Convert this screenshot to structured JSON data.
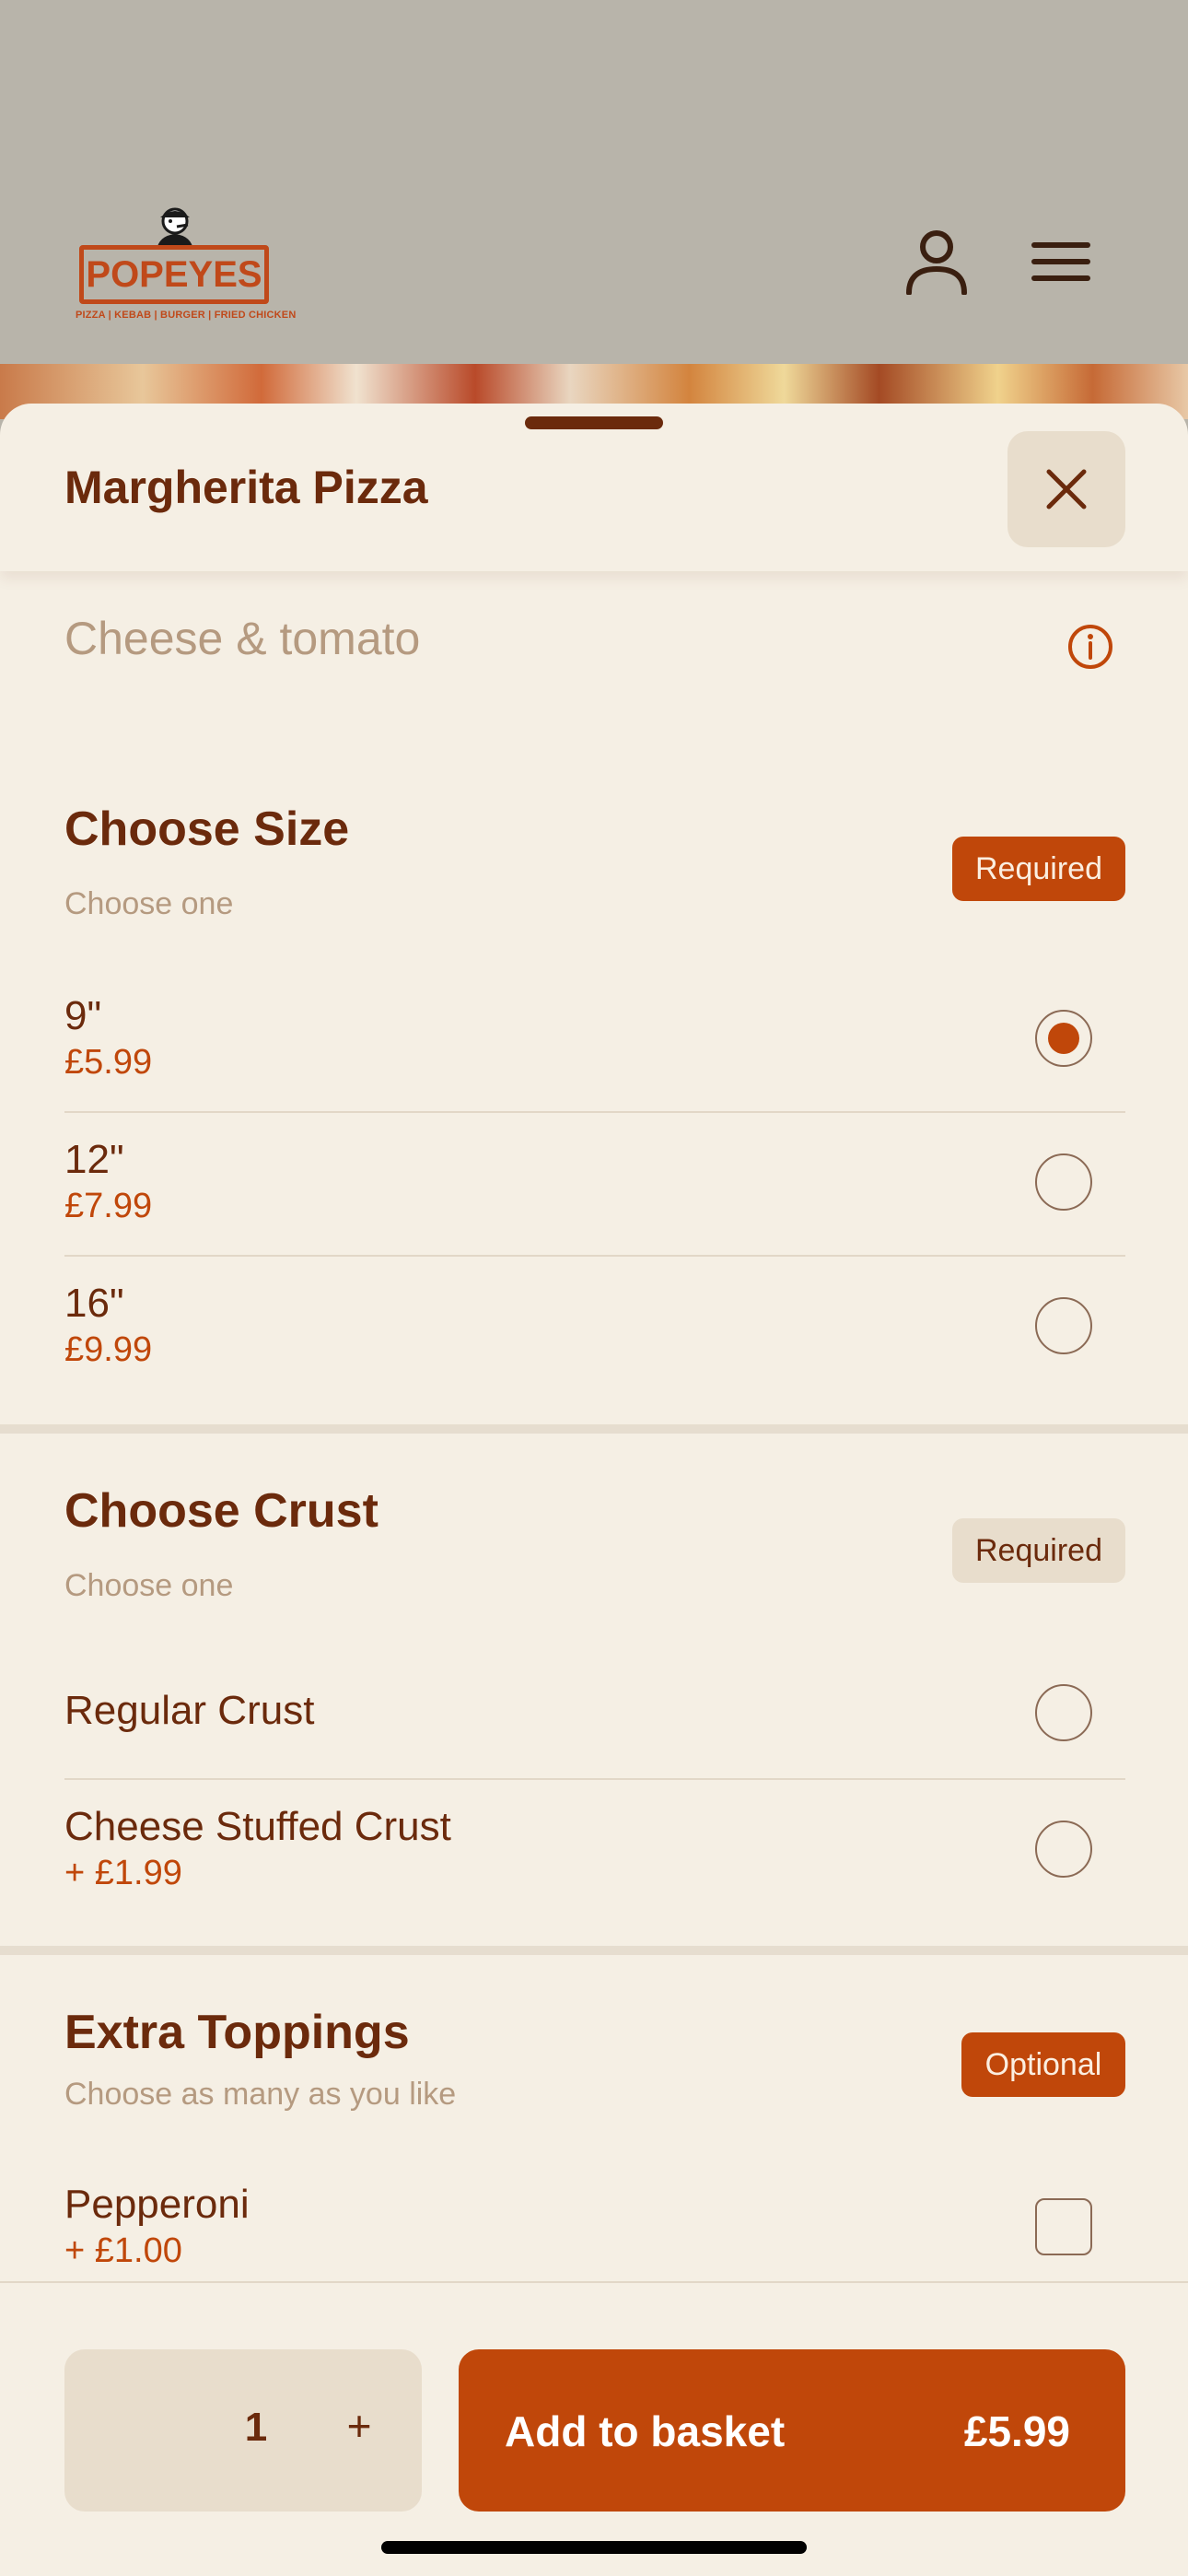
{
  "header": {
    "logo_text": "POPEYES",
    "logo_tagline": "PIZZA | KEBAB | BURGER | FRIED CHICKEN",
    "icons": {
      "account": "user-icon",
      "menu": "hamburger-menu-icon"
    }
  },
  "sheet": {
    "title": "Margherita Pizza",
    "description": "Cheese & tomato",
    "close_icon": "close-icon",
    "info_icon": "info-icon"
  },
  "sections": [
    {
      "title": "Choose Size",
      "subtitle": "Choose one",
      "badge": "Required",
      "options": [
        {
          "label": "9\"",
          "price": "£5.99",
          "selected": true
        },
        {
          "label": "12\"",
          "price": "£7.99",
          "selected": false
        },
        {
          "label": "16\"",
          "price": "£9.99",
          "selected": false
        }
      ]
    },
    {
      "title": "Choose Crust",
      "subtitle": "Choose one",
      "badge": "Required",
      "options": [
        {
          "label": "Regular Crust",
          "price": "",
          "selected": false
        },
        {
          "label": "Cheese Stuffed Crust",
          "price": "+ £1.99",
          "selected": false
        }
      ]
    },
    {
      "title": "Extra Toppings",
      "subtitle": "Choose as many as you like",
      "badge": "Optional",
      "options": [
        {
          "label": "Pepperoni",
          "price": "+ £1.00",
          "selected": false
        }
      ]
    }
  ],
  "footer": {
    "quantity": "1",
    "plus": "+",
    "add_label": "Add to basket",
    "total": "£5.99"
  },
  "colors": {
    "accent": "#c0470a",
    "text_dark": "#6b2a0c",
    "sheet_bg": "#f5efe4",
    "muted": "#b59a80"
  }
}
